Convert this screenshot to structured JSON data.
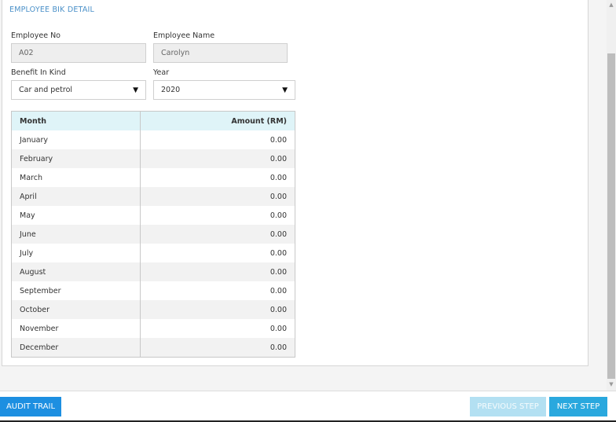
{
  "section": {
    "title": "EMPLOYEE BIK DETAIL"
  },
  "form": {
    "employee_no_label": "Employee No",
    "employee_no_value": "A02",
    "employee_name_label": "Employee Name",
    "employee_name_value": "Carolyn",
    "bik_label": "Benefit In Kind",
    "bik_value": "Car and petrol",
    "year_label": "Year",
    "year_value": "2020"
  },
  "table": {
    "headers": {
      "month": "Month",
      "amount": "Amount (RM)"
    },
    "rows": [
      {
        "month": "January",
        "amount": "0.00"
      },
      {
        "month": "February",
        "amount": "0.00"
      },
      {
        "month": "March",
        "amount": "0.00"
      },
      {
        "month": "April",
        "amount": "0.00"
      },
      {
        "month": "May",
        "amount": "0.00"
      },
      {
        "month": "June",
        "amount": "0.00"
      },
      {
        "month": "July",
        "amount": "0.00"
      },
      {
        "month": "August",
        "amount": "0.00"
      },
      {
        "month": "September",
        "amount": "0.00"
      },
      {
        "month": "October",
        "amount": "0.00"
      },
      {
        "month": "November",
        "amount": "0.00"
      },
      {
        "month": "December",
        "amount": "0.00"
      }
    ]
  },
  "footer": {
    "audit_label": "AUDIT TRAIL",
    "prev_label": "PREVIOUS STEP",
    "next_label": "NEXT STEP"
  },
  "icons": {
    "dropdown_arrow": "▼",
    "scroll_up": "▲",
    "scroll_down": "▼"
  },
  "colors": {
    "primary": "#1d8fe1",
    "next": "#2aa8de",
    "prev_disabled": "#b3e0f2",
    "title": "#4a90c8",
    "table_header": "#dff4f8"
  }
}
